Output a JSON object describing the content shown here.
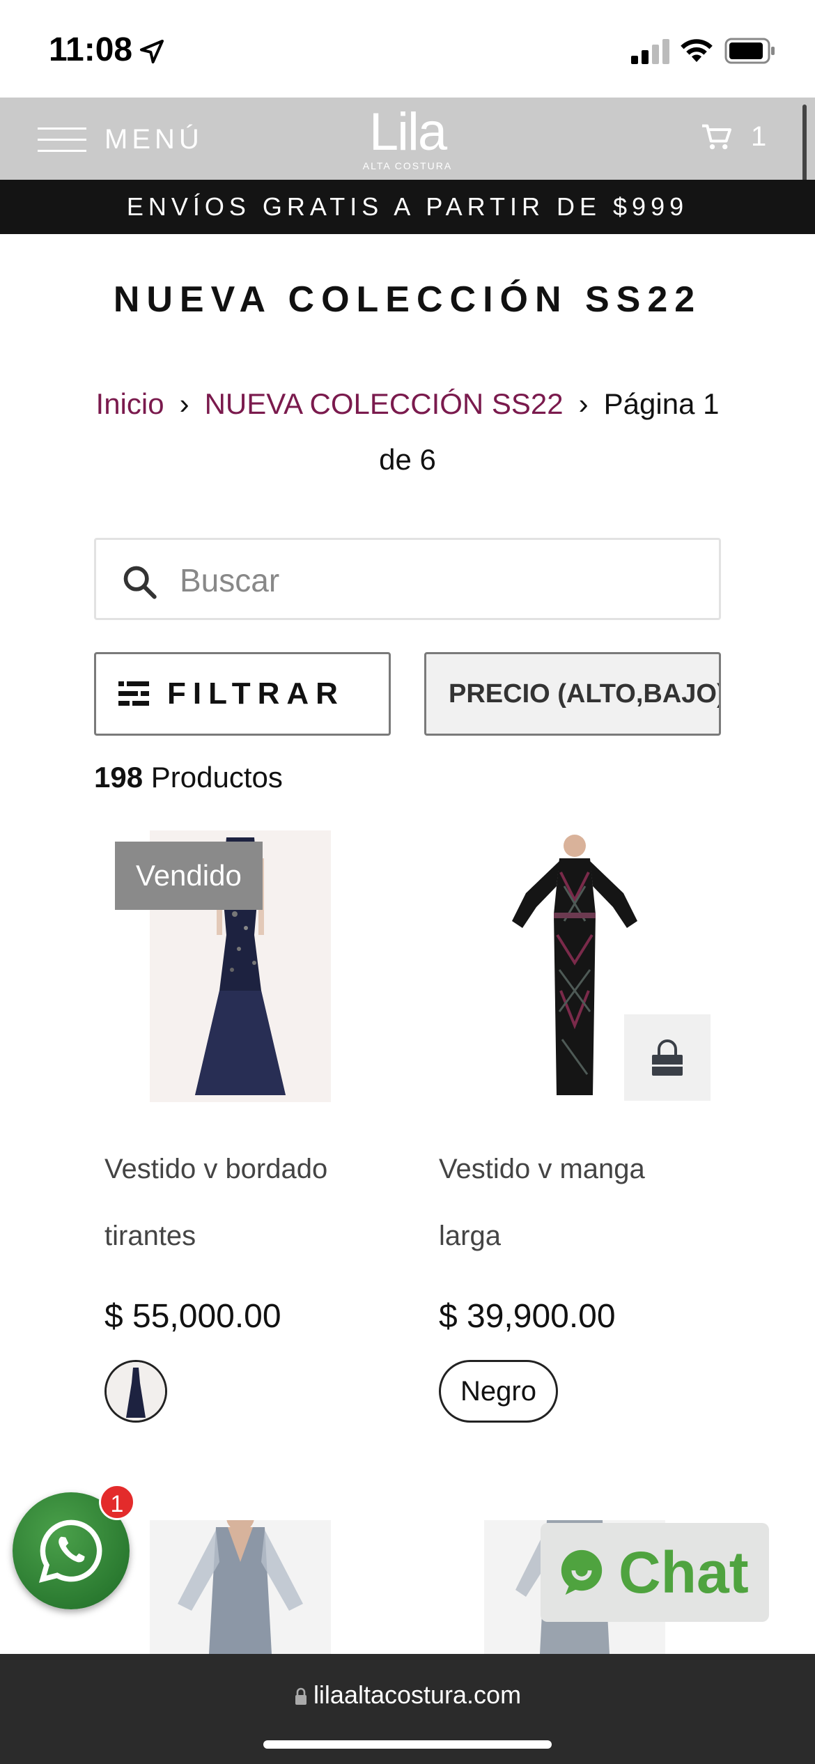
{
  "status": {
    "time": "11:08"
  },
  "header": {
    "menu_label": "MENÚ",
    "logo_main": "Lila",
    "logo_sub": "ALTA COSTURA",
    "cart_count": "1"
  },
  "promo": {
    "text": "ENVÍOS GRATIS A PARTIR DE $999"
  },
  "page": {
    "title": "NUEVA COLECCIÓN SS22"
  },
  "breadcrumb": {
    "home": "Inicio",
    "collection": "NUEVA COLECCIÓN SS22",
    "current": "Página 1 de 6"
  },
  "search": {
    "placeholder": "Buscar"
  },
  "controls": {
    "filter_label": "FILTRAR",
    "sort_label": "PRECIO (ALTO,BAJO)"
  },
  "results": {
    "count": "198",
    "label": "Productos"
  },
  "products": [
    {
      "name_line1": "Vestido v bordado",
      "name_line2": "tirantes",
      "price": "$ 55,000.00",
      "badge": "Vendido"
    },
    {
      "name_line1": "Vestido v manga",
      "name_line2": "larga",
      "price": "$ 39,900.00",
      "variant": "Negro"
    }
  ],
  "floating": {
    "whatsapp_badge": "1",
    "chat_label": "Chat"
  },
  "browser": {
    "url": "lilaaltacostura.com"
  },
  "colors": {
    "header_bg": "#cacaca",
    "promo_bg": "#141414",
    "link": "#7a1a4d",
    "chat_green": "#4fa33f"
  }
}
